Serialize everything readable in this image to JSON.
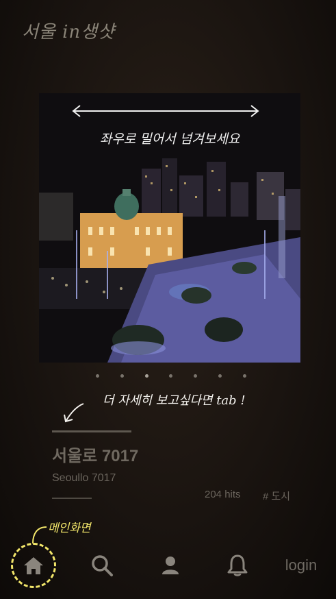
{
  "app": {
    "title": "서울 in생샷"
  },
  "carousel": {
    "swipe_hint": "좌우로 밀어서 넘겨보세요",
    "slide_count": 7,
    "active_index": 2
  },
  "tab_hint": "더 자세히 보고싶다면 tab !",
  "place": {
    "name": "서울로 7017",
    "subtitle": "Seoullo 7017",
    "hits": "204 hits",
    "tag": "# 도시"
  },
  "main_hint": "메인화면",
  "nav": {
    "items": [
      {
        "icon": "home-icon"
      },
      {
        "icon": "search-icon"
      },
      {
        "icon": "user-icon"
      },
      {
        "icon": "bell-icon"
      }
    ],
    "login_label": "login"
  },
  "colors": {
    "highlight": "#f2e66a",
    "muted_text": "#6b655d"
  }
}
